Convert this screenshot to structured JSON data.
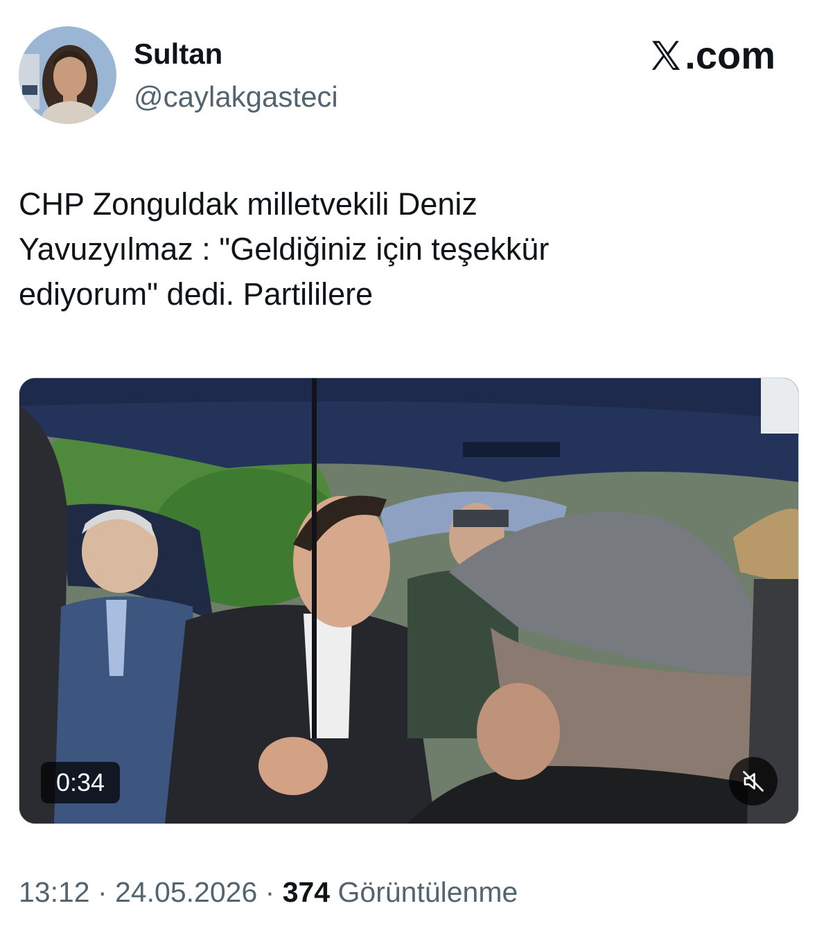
{
  "author": {
    "display_name": "Sultan",
    "handle": "@caylakgasteci"
  },
  "brand": {
    "logo_icon": "x-logo-icon",
    "domain_suffix": ".com"
  },
  "tweet": {
    "text": "CHP Zonguldak milletvekili Deniz\nYavuzyılmaz : \"Geldiğiniz için teşekkür\nediyorum\" dedi. Partililere"
  },
  "media": {
    "duration": "0:34",
    "mute_icon": "speaker-muted-icon"
  },
  "meta": {
    "time": "13:12",
    "separator1": " · ",
    "date": "24.05.2026",
    "separator2": " · ",
    "views_count": "374",
    "views_label": " Görüntülenme"
  }
}
